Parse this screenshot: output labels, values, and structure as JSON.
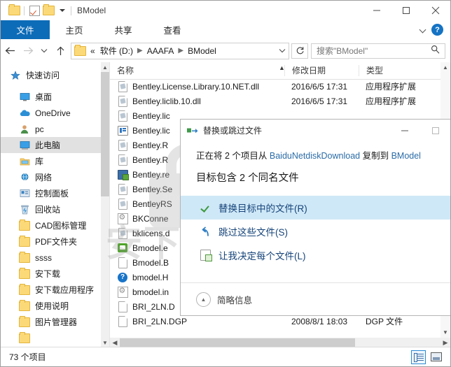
{
  "window": {
    "title": "BModel",
    "quick_access": [
      "folder-icon",
      "properties-icon",
      "new-folder-icon",
      "customize-caret"
    ],
    "controls": {
      "minimize": "minimize-icon",
      "maximize": "maximize-icon",
      "close": "close-icon"
    }
  },
  "ribbon": {
    "tabs": [
      {
        "label": "文件",
        "active": true
      },
      {
        "label": "主页",
        "active": false
      },
      {
        "label": "共享",
        "active": false
      },
      {
        "label": "查看",
        "active": false
      }
    ],
    "collapse": "chevron-down-icon",
    "help": "?"
  },
  "nav": {
    "back": "◄",
    "forward": "►",
    "recent": "⌄",
    "up": "↑",
    "breadcrumb": [
      "«",
      "软件 (D:)",
      "AAAFA",
      "BModel"
    ],
    "dropdown": "⌄",
    "refresh": "↻"
  },
  "search": {
    "placeholder": "搜索\"BModel\"",
    "icon": "search-icon"
  },
  "sidebar": {
    "items": [
      {
        "label": "快速访问",
        "icon": "star-icon",
        "indent": false,
        "selected": false
      },
      {
        "label": "桌面",
        "icon": "desktop-icon",
        "indent": true,
        "selected": false
      },
      {
        "label": "OneDrive",
        "icon": "cloud-icon",
        "indent": true,
        "selected": false
      },
      {
        "label": "pc",
        "icon": "user-icon",
        "indent": true,
        "selected": false
      },
      {
        "label": "此电脑",
        "icon": "computer-icon",
        "indent": true,
        "selected": true
      },
      {
        "label": "库",
        "icon": "library-icon",
        "indent": true,
        "selected": false
      },
      {
        "label": "网络",
        "icon": "network-icon",
        "indent": true,
        "selected": false
      },
      {
        "label": "控制面板",
        "icon": "control-panel-icon",
        "indent": true,
        "selected": false
      },
      {
        "label": "回收站",
        "icon": "recycle-bin-icon",
        "indent": true,
        "selected": false
      },
      {
        "label": "CAD图标管理",
        "icon": "folder-icon",
        "indent": true,
        "selected": false
      },
      {
        "label": "PDF文件夹",
        "icon": "folder-icon",
        "indent": true,
        "selected": false
      },
      {
        "label": "ssss",
        "icon": "folder-icon",
        "indent": true,
        "selected": false
      },
      {
        "label": "安下载",
        "icon": "folder-icon",
        "indent": true,
        "selected": false
      },
      {
        "label": "安下载应用程序",
        "icon": "folder-icon",
        "indent": true,
        "selected": false
      },
      {
        "label": "使用说明",
        "icon": "folder-icon",
        "indent": true,
        "selected": false
      },
      {
        "label": "图片管理器",
        "icon": "folder-icon",
        "indent": true,
        "selected": false
      }
    ]
  },
  "filelist": {
    "columns": [
      {
        "label": "名称",
        "sorted": true
      },
      {
        "label": "修改日期",
        "sorted": false
      },
      {
        "label": "类型",
        "sorted": false
      }
    ],
    "rows": [
      {
        "name": "Bentley.License.Library.10.NET.dll",
        "date": "2016/6/5 17:31",
        "type": "应用程序扩展",
        "icon": "dll-file-icon"
      },
      {
        "name": "Bentley.liclib.10.dll",
        "date": "2016/6/5 17:31",
        "type": "应用程序扩展",
        "icon": "dll-file-icon"
      },
      {
        "name": "Bentley.lic",
        "date": "",
        "type": "",
        "icon": "dll-file-icon"
      },
      {
        "name": "Bentley.lic",
        "date": "",
        "type": "",
        "icon": "blue-file-icon"
      },
      {
        "name": "Bentley.R",
        "date": "",
        "type": "",
        "icon": "dll-file-icon"
      },
      {
        "name": "Bentley.R",
        "date": "",
        "type": "",
        "icon": "dll-file-icon"
      },
      {
        "name": "Bentley.re",
        "date": "",
        "type": "",
        "icon": "resource-file-icon"
      },
      {
        "name": "Bentley.Se",
        "date": "",
        "type": "",
        "icon": "dll-file-icon"
      },
      {
        "name": "BentleyRS",
        "date": "",
        "type": "",
        "icon": "dll-file-icon"
      },
      {
        "name": "BKConne",
        "date": "",
        "type": "",
        "icon": "config-file-icon"
      },
      {
        "name": "bklicens.d",
        "date": "",
        "type": "",
        "icon": "dll-file-icon"
      },
      {
        "name": "Bmodel.e",
        "date": "",
        "type": "",
        "icon": "app-file-icon"
      },
      {
        "name": "Bmodel.B",
        "date": "",
        "type": "",
        "icon": "plain-file-icon"
      },
      {
        "name": "bmodel.H",
        "date": "",
        "type": "",
        "icon": "help-file-icon"
      },
      {
        "name": "bmodel.in",
        "date": "",
        "type": "",
        "icon": "config-file-icon"
      },
      {
        "name": "BRI_2LN.D",
        "date": "",
        "type": "",
        "icon": "plain-file-icon"
      },
      {
        "name": "BRI_2LN.DGP",
        "date": "2008/8/1 18:03",
        "type": "DGP 文件",
        "icon": "plain-file-icon"
      }
    ]
  },
  "statusbar": {
    "count": "73 个项目",
    "views": [
      {
        "name": "details-view",
        "active": true
      },
      {
        "name": "large-icons-view",
        "active": false
      }
    ]
  },
  "dialog": {
    "title": "替换或跳过文件",
    "title_icon": "copy-move-icon",
    "minimize": "minimize-icon",
    "maximize": "maximize-icon",
    "line1_prefix": "正在将 2 个项目从 ",
    "line1_source": "BaiduNetdiskDownload",
    "line1_middle": " 复制到 ",
    "line1_target": "BModel",
    "line2": "目标包含 2 个同名文件",
    "options": [
      {
        "label": "替换目标中的文件(R)",
        "icon": "green-check-icon",
        "hover": true
      },
      {
        "label": "跳过这些文件(S)",
        "icon": "skip-arrow-icon",
        "hover": false
      },
      {
        "label": "让我决定每个文件(L)",
        "icon": "compare-files-icon",
        "hover": false
      }
    ],
    "footer": {
      "label": "简略信息",
      "icon": "chevron-up-circle-icon"
    }
  },
  "watermark": {
    "text": "安下载",
    "url": "anxz.com"
  },
  "colors": {
    "accent": "#0d6cb8",
    "link": "#2b6ca8",
    "hover": "#cfe8f7",
    "selection": "#e1e1e1"
  }
}
